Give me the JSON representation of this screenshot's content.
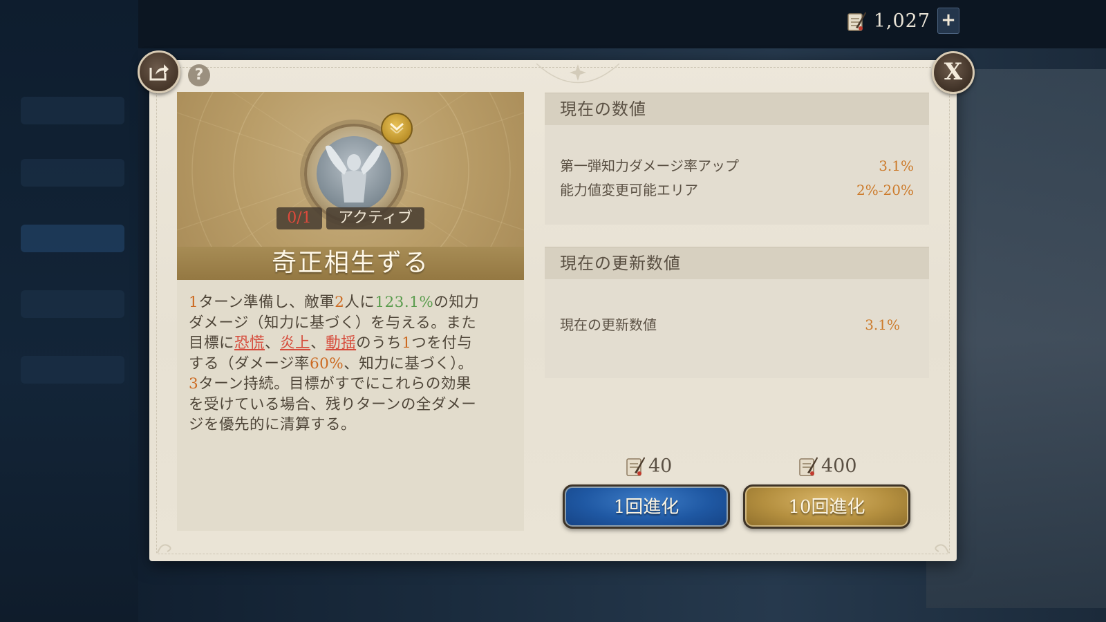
{
  "currency": {
    "value": "1,027",
    "plus_label": "+",
    "icon": "scroll-quill-icon"
  },
  "dialog": {
    "help_label": "?",
    "close_label": "X",
    "share_icon": "share-icon"
  },
  "skill": {
    "count": "0/1",
    "type": "アクティブ",
    "name": "奇正相生ずる",
    "rank_icon": "chevron-down-icon",
    "description": [
      [
        {
          "t": "1",
          "c": "o"
        },
        {
          "t": "ターン準備し、敵軍"
        },
        {
          "t": "2",
          "c": "o"
        },
        {
          "t": "人に"
        },
        {
          "t": "123.1%",
          "c": "g"
        },
        {
          "t": "の知力"
        }
      ],
      [
        {
          "t": "ダメージ（知力に基づく）を与える。また"
        }
      ],
      [
        {
          "t": "目標に"
        },
        {
          "t": "恐慌",
          "c": "r"
        },
        {
          "t": "、"
        },
        {
          "t": "炎上",
          "c": "r"
        },
        {
          "t": "、"
        },
        {
          "t": "動揺",
          "c": "r"
        },
        {
          "t": "のうち"
        },
        {
          "t": "1",
          "c": "o"
        },
        {
          "t": "つを付与"
        }
      ],
      [
        {
          "t": "する（ダメージ率"
        },
        {
          "t": "60%",
          "c": "o"
        },
        {
          "t": "、知力に基づく）。"
        }
      ],
      [
        {
          "t": "3",
          "c": "o"
        },
        {
          "t": "ターン持続。目標がすでにこれらの効果"
        }
      ],
      [
        {
          "t": "を受けている場合、残りターンの全ダメー"
        }
      ],
      [
        {
          "t": "ジを優先的に清算する。"
        }
      ]
    ]
  },
  "current_values": {
    "header": "現在の数値",
    "rows": [
      {
        "label": "第一弾知力ダメージ率アップ",
        "value": "3.1%"
      },
      {
        "label": "能力値変更可能エリア",
        "value": "2%-20%"
      }
    ]
  },
  "updated_values": {
    "header": "現在の更新数値",
    "rows": [
      {
        "label": "現在の更新数値",
        "value": "3.1%"
      }
    ]
  },
  "actions": {
    "evolve_once": {
      "label": "1回進化",
      "cost": "40"
    },
    "evolve_ten": {
      "label": "10回進化",
      "cost": "400"
    }
  },
  "colors": {
    "highlight_orange": "#cc6a21",
    "highlight_green": "#5a9c4d",
    "highlight_red": "#d64b3b",
    "button_blue": "#1f58a3",
    "button_gold": "#b48f3f"
  }
}
